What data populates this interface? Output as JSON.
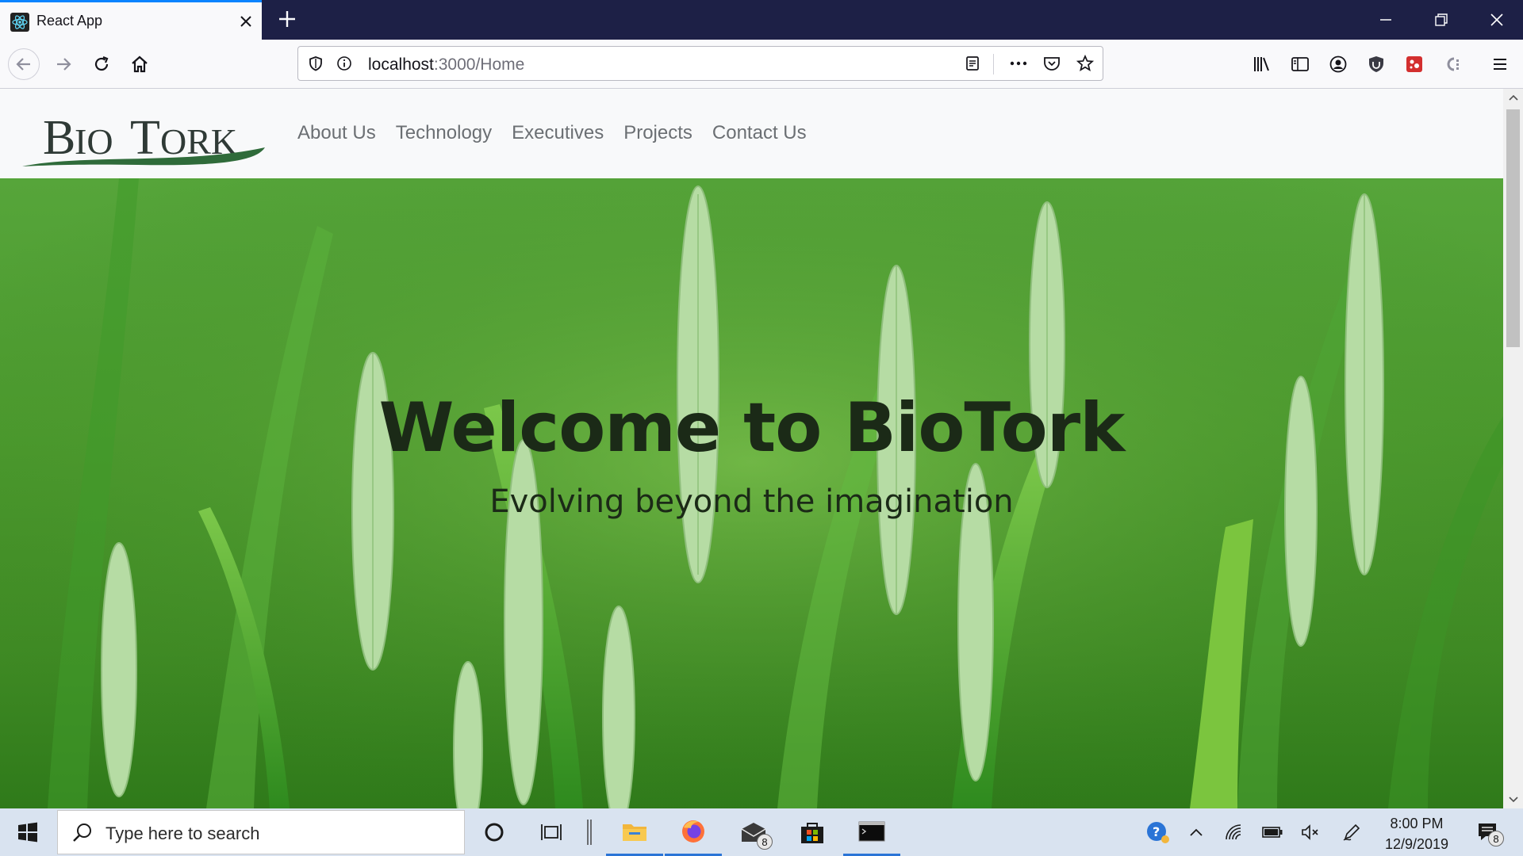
{
  "browser": {
    "tab_title": "React App",
    "url_host": "localhost",
    "url_path": ":3000/Home"
  },
  "site": {
    "logo_text": "BioTork",
    "nav": [
      "About Us",
      "Technology",
      "Executives",
      "Projects",
      "Contact Us"
    ],
    "hero_title": "Welcome to BioTork",
    "hero_subtitle": "Evolving beyond the imagination"
  },
  "taskbar": {
    "search_placeholder": "Type here to search",
    "mail_badge": "8",
    "notification_badge": "8",
    "time": "8:00 PM",
    "date": "12/9/2019"
  },
  "colors": {
    "tab_strip": "#1d2046",
    "accent": "#0a84ff",
    "logo_green": "#2f6b3a",
    "hero_text": "#1b2a17"
  }
}
